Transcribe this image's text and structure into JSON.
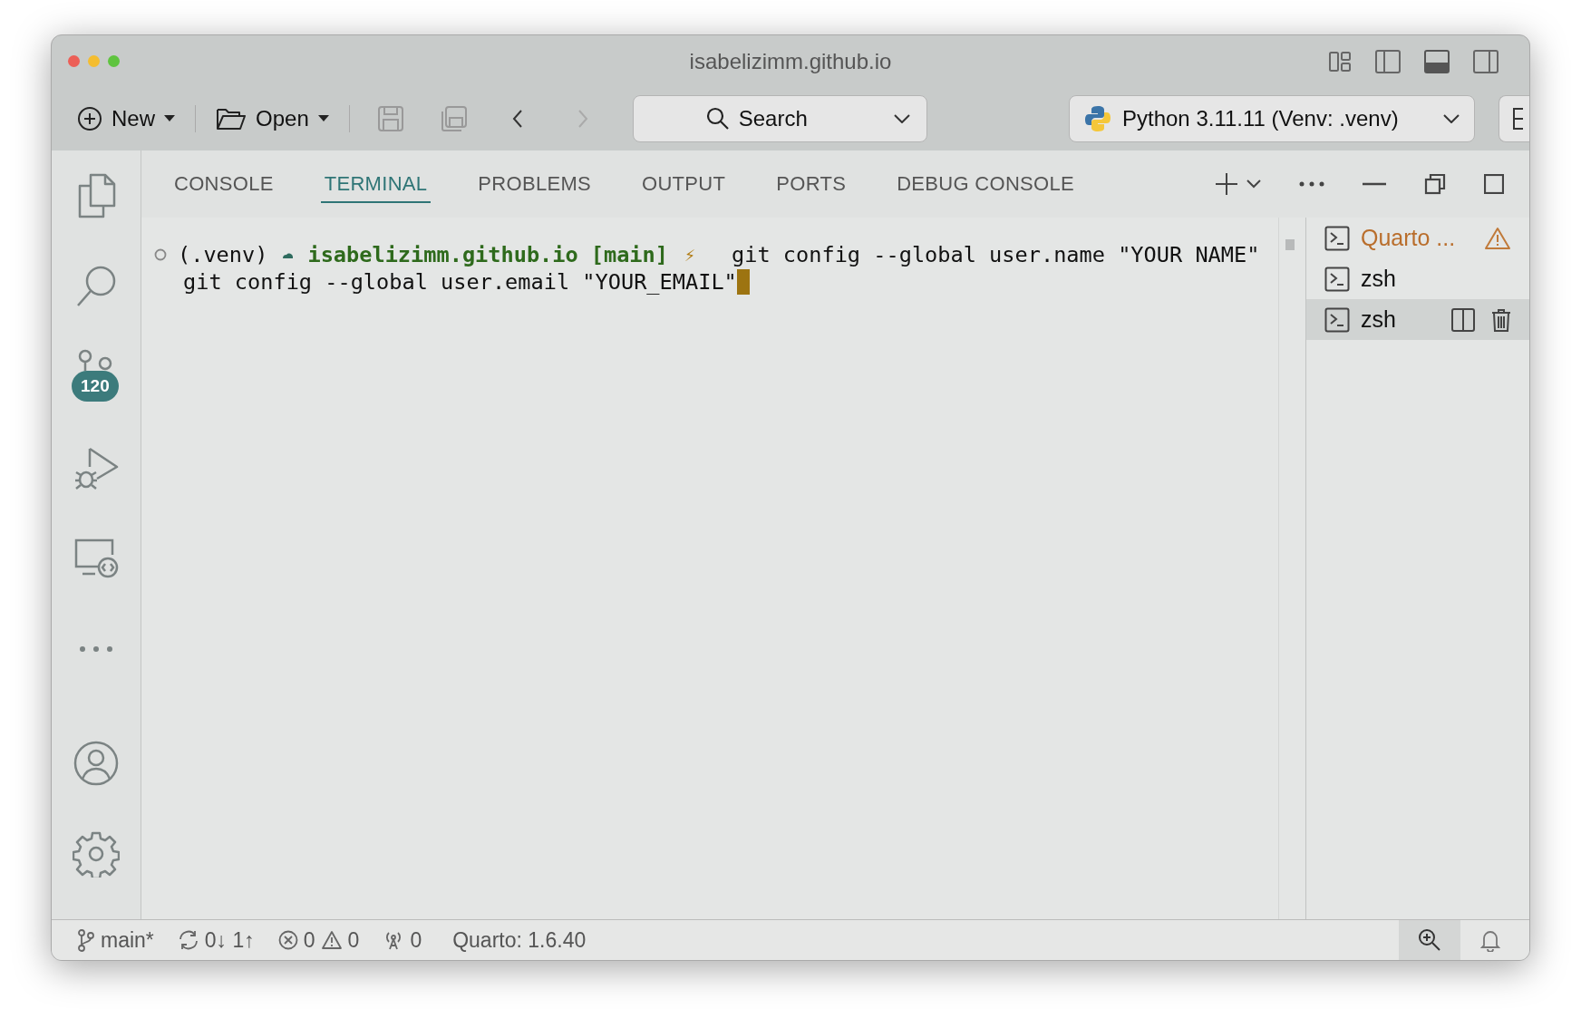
{
  "window": {
    "title": "isabelizimm.github.io"
  },
  "toolbar": {
    "new_label": "New",
    "open_label": "Open",
    "search": "Search",
    "interpreter": "Python 3.11.11 (Venv: .venv)"
  },
  "activity_bar": {
    "items": [
      {
        "kind": "explorer"
      },
      {
        "kind": "search"
      },
      {
        "kind": "source-control",
        "badge": "120"
      },
      {
        "kind": "run-debug"
      },
      {
        "kind": "remote"
      },
      {
        "kind": "more"
      }
    ],
    "bottom": [
      {
        "kind": "account"
      },
      {
        "kind": "settings"
      }
    ]
  },
  "panel": {
    "tabs": [
      {
        "label": "CONSOLE",
        "selected": false
      },
      {
        "label": "TERMINAL",
        "selected": true
      },
      {
        "label": "PROBLEMS",
        "selected": false
      },
      {
        "label": "OUTPUT",
        "selected": false
      },
      {
        "label": "PORTS",
        "selected": false
      },
      {
        "label": "DEBUG CONSOLE",
        "selected": false
      }
    ]
  },
  "terminal": {
    "venv": "(.venv)",
    "directory": "isabelizimm.github.io",
    "branch": "[main]",
    "lightning": "⚡",
    "command": "git config --global user.name \"YOUR NAME\"",
    "continuation": "git config --global user.email \"YOUR_EMAIL\""
  },
  "terminal_list": [
    {
      "name": "Quarto ...",
      "warning": true,
      "selected": false
    },
    {
      "name": "zsh",
      "warning": false,
      "selected": false
    },
    {
      "name": "zsh",
      "warning": false,
      "selected": true
    }
  ],
  "status_bar": {
    "branch": "main*",
    "sync": "0↓ 1↑",
    "errors": "0",
    "warnings": "0",
    "ports": "0",
    "quarto": "Quarto: 1.6.40"
  }
}
